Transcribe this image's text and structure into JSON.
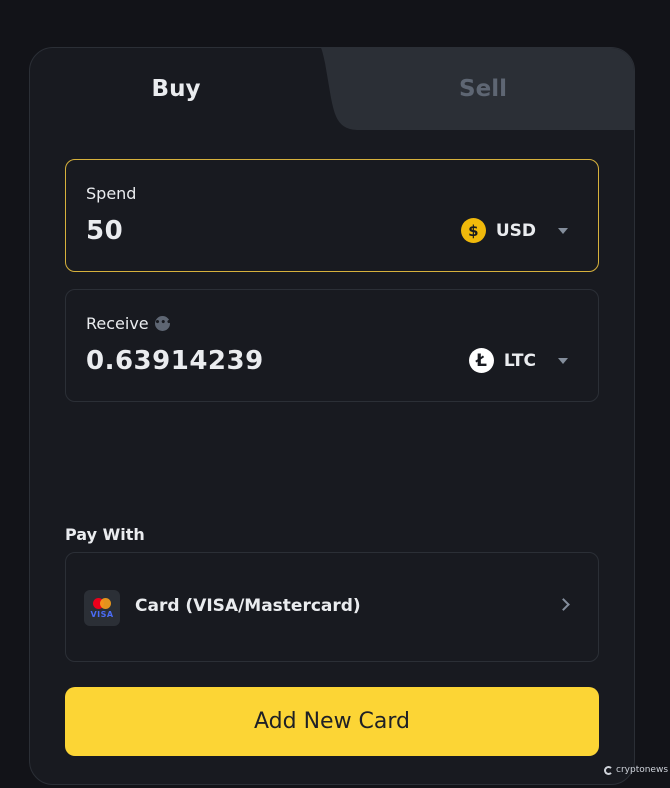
{
  "tabs": {
    "buy": "Buy",
    "sell": "Sell",
    "active": "buy"
  },
  "spend": {
    "label": "Spend",
    "amount": "50",
    "currency": "USD",
    "currency_icon": "dollar-coin-icon"
  },
  "receive": {
    "label": "Receive",
    "amount": "0.63914239",
    "currency": "LTC",
    "currency_icon": "litecoin-icon"
  },
  "pay_with": {
    "label": "Pay With",
    "method": "Card (VISA/Mastercard)",
    "card_brand_text": "VISA"
  },
  "add_card_button": "Add New Card",
  "watermark": "cryptonews",
  "colors": {
    "accent": "#fcd535",
    "spend_border": "#d6b13c",
    "panel_bg": "#181a20",
    "page_bg": "#121318",
    "sell_tab_bg": "#2b2f36"
  }
}
